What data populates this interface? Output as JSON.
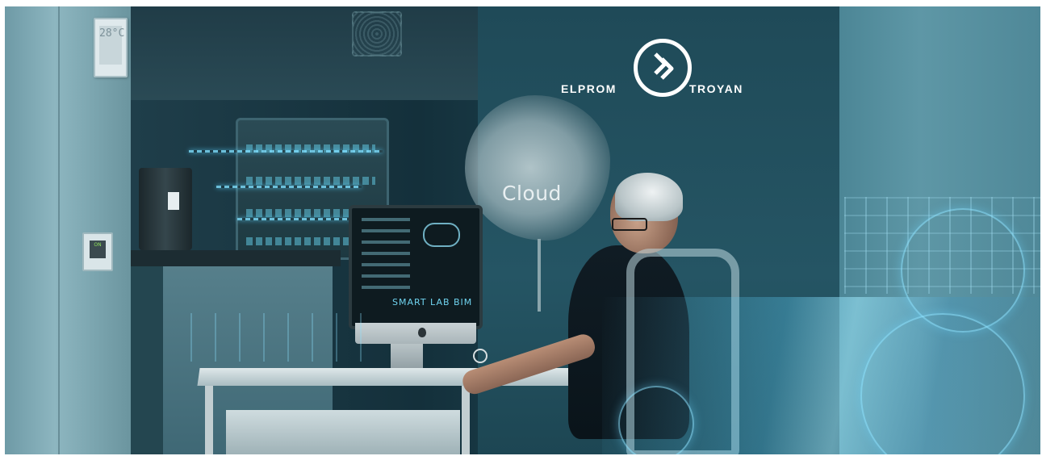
{
  "scene": {
    "thermostat_display": "28°C",
    "switch_label": "ON",
    "cloud_label": "Cloud",
    "monitor_screen_text": "SMART LAB BIM"
  },
  "logo": {
    "left_word": "ELPROM",
    "right_word": "TROYAN",
    "icon": "elprom-emblem-icon"
  },
  "colors": {
    "scene_tone": "#1f4a58",
    "hologram": "#8ce1ff",
    "logo": "#ffffff"
  }
}
